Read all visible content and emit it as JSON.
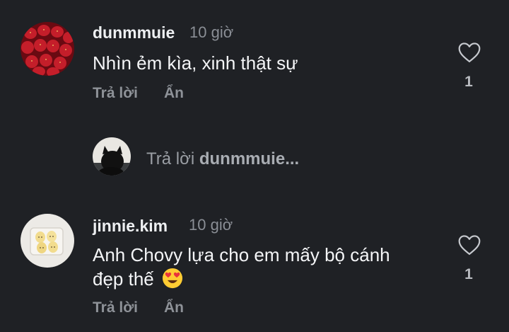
{
  "comments": [
    {
      "username": "dunmmuie",
      "time": "10 giờ",
      "text": "Nhìn ẻm kìa, xinh thật sự",
      "reply_label": "Trả lời",
      "hide_label": "Ẩn",
      "like_count": "1",
      "avatar_icon": "strawberries-avatar"
    },
    {
      "username": "jinnie.kim",
      "time": "10 giờ",
      "text_line1": "Anh Chovy lựa cho em mấy bộ cánh",
      "text_line2": "đẹp thế",
      "emoji": "heart-eyes-emoji",
      "reply_label": "Trả lời",
      "hide_label": "Ẩn",
      "like_count": "1",
      "avatar_icon": "eggs-avatar"
    }
  ],
  "reply_bar": {
    "prefix": "Trả lời",
    "target": "dunmmuie..."
  },
  "colors": {
    "background": "#1f2125",
    "muted": "#8e9298",
    "heart_emoji": "#e8323c",
    "emoji_face": "#ffcc33"
  }
}
